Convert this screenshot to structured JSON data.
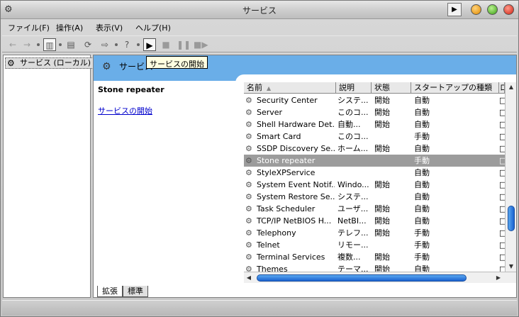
{
  "window": {
    "title": "サービス"
  },
  "menu": [
    "ファイル(F)",
    "操作(A)",
    "表示(V)",
    "ヘルプ(H)"
  ],
  "tooltip": "サービスの開始",
  "tree": {
    "root_label": "サービス (ローカル)"
  },
  "pane": {
    "header_title": "サービス",
    "selected_name": "Stone repeater",
    "start_link": "サービスの開始"
  },
  "list": {
    "columns": [
      "名前",
      "説明",
      "状態",
      "スタートアップの種類",
      "ロ"
    ],
    "rows": [
      {
        "name": "Security Center",
        "desc": "システ...",
        "status": "開始",
        "startup": "自動"
      },
      {
        "name": "Server",
        "desc": "このコ...",
        "status": "開始",
        "startup": "自動"
      },
      {
        "name": "Shell Hardware Det...",
        "desc": "自動...",
        "status": "開始",
        "startup": "自動"
      },
      {
        "name": "Smart Card",
        "desc": "このコ...",
        "status": "",
        "startup": "手動"
      },
      {
        "name": "SSDP Discovery Se...",
        "desc": "ホーム...",
        "status": "開始",
        "startup": "自動"
      },
      {
        "name": "Stone repeater",
        "desc": "",
        "status": "",
        "startup": "手動"
      },
      {
        "name": "StyleXPService",
        "desc": "",
        "status": "",
        "startup": "自動"
      },
      {
        "name": "System Event Notif...",
        "desc": "Windo...",
        "status": "開始",
        "startup": "自動"
      },
      {
        "name": "System Restore Se...",
        "desc": "システ...",
        "status": "",
        "startup": "自動"
      },
      {
        "name": "Task Scheduler",
        "desc": "ユーザ...",
        "status": "開始",
        "startup": "自動"
      },
      {
        "name": "TCP/IP NetBIOS H...",
        "desc": "NetBI...",
        "status": "開始",
        "startup": "自動"
      },
      {
        "name": "Telephony",
        "desc": "テレフ...",
        "status": "開始",
        "startup": "手動"
      },
      {
        "name": "Telnet",
        "desc": "リモー...",
        "status": "",
        "startup": "手動"
      },
      {
        "name": "Terminal Services",
        "desc": "複数...",
        "status": "開始",
        "startup": "手動"
      },
      {
        "name": "Themes",
        "desc": "テーマ...",
        "status": "開始",
        "startup": "自動"
      }
    ],
    "selected_index": 5
  },
  "tabs": [
    "拡張",
    "標準"
  ]
}
